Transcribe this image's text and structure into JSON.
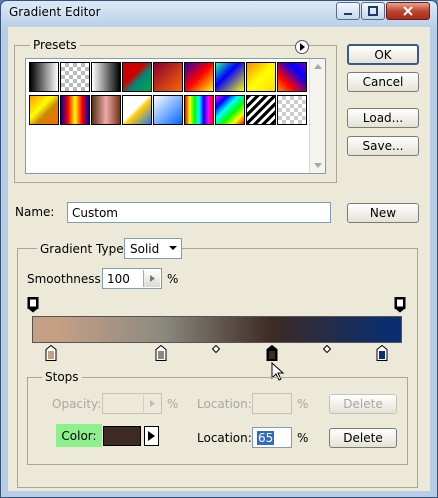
{
  "window": {
    "title": "Gradient Editor"
  },
  "buttons": {
    "ok": "OK",
    "cancel": "Cancel",
    "load": "Load...",
    "save": "Save...",
    "new": "New",
    "delete": "Delete"
  },
  "presets": {
    "label": "Presets",
    "swatches": [
      "linear-gradient(90deg,#000,#fff)",
      "repeating-conic-gradient(#bbb 0 25%,#fff 0 50%) 0 0/8px 8px",
      "linear-gradient(90deg,#fff,#000)",
      "linear-gradient(135deg,#c00,#c00 40%,#087 60%,#0a4)",
      "linear-gradient(135deg,#803,#f60)",
      "linear-gradient(135deg,#30a,#f00 50%,#ff0)",
      "linear-gradient(135deg,#2f9,#00f 40%,#ff0)",
      "linear-gradient(135deg,#f80,#ff0 50%,#fd0)",
      "linear-gradient(45deg,#f80,#f00 30%,#00f 70%,#60c)",
      "linear-gradient(135deg,#f90,#ff0 40%,#c80 60%,#f60)",
      "linear-gradient(90deg,#00a,#f00,#ff0,#f00,#00a)",
      "linear-gradient(90deg,#531,#eaa 50%,#731)",
      "linear-gradient(135deg,#fff 45%,#fc0 55%,#27f)",
      "linear-gradient(135deg,#fff,#06f)",
      "linear-gradient(90deg,#f00,#ff0,#0f0,#0ff,#00f,#f0f,#f00)",
      "linear-gradient(135deg,#f0f,#00f,#0ff,#0f0,#ff0,#f00)",
      "repeating-linear-gradient(135deg,#000 0 3px,#fff 3px 6px)",
      "repeating-conic-gradient(#ccc 0 25%,#fff 0 50%) 0 0/8px 8px"
    ]
  },
  "name": {
    "label": "Name:",
    "value": "Custom"
  },
  "gradient": {
    "type_label": "Gradient Type:",
    "type_value": "Solid",
    "smoothness_label": "Smoothness:",
    "smoothness_value": "100",
    "smoothness_unit": "%",
    "colors": {
      "stop1": "#c6a085",
      "stop2": "#8c8a80",
      "stop3": "#3d2a24",
      "stop4": "#0b2e70"
    }
  },
  "stops": {
    "label": "Stops",
    "opacity_label": "Opacity:",
    "opacity_unit": "%",
    "location_label": "Location:",
    "location_unit": "%",
    "color_label": "Color:",
    "color_value": "#3d2a24",
    "color_location_label": "Location:",
    "color_location_value": "65",
    "color_location_unit": "%"
  }
}
